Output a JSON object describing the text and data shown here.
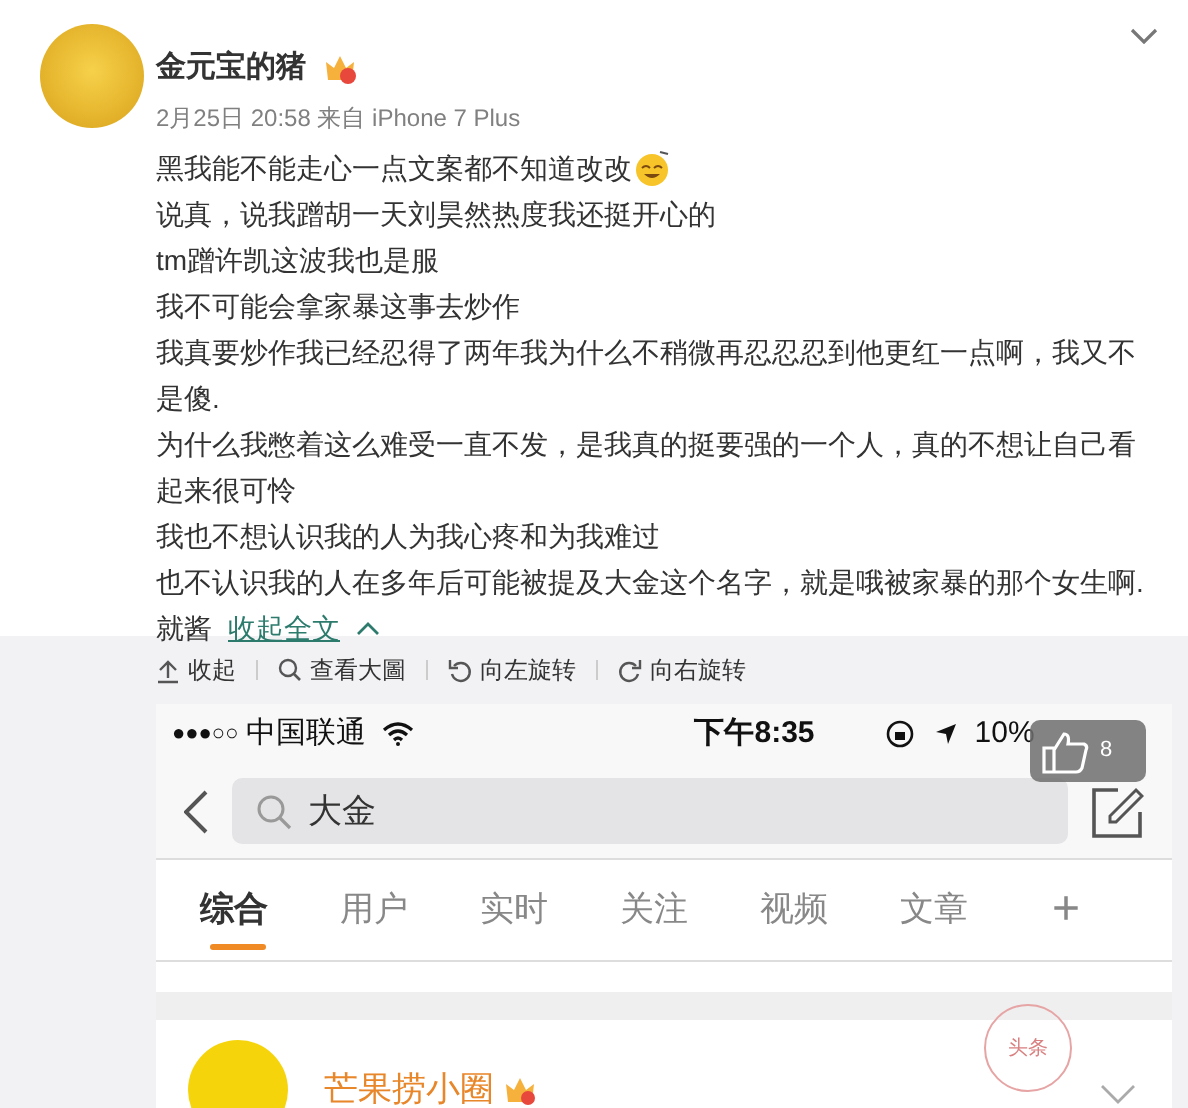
{
  "post": {
    "author": "金元宝的猪",
    "meta": "2月25日 20:58 来自 iPhone 7 Plus",
    "paragraphs": [
      "黑我能不能走心一点文案都不知道改改",
      "说真，说我蹭胡一天刘昊然热度我还挺开心的",
      "tm蹭许凯这波我也是服",
      "我不可能会拿家暴这事去炒作",
      "我真要炒作我已经忍得了两年我为什么不稍微再忍忍忍到他更红一点啊，我又不是傻.",
      "为什么我憋着这么难受一直不发，是我真的挺要强的一个人，真的不想让自己看起来很可怜",
      "我也不想认识我的人为我心疼和为我难过",
      "也不认识我的人在多年后可能被提及大金这个名字，就是哦被家暴的那个女生啊."
    ],
    "last_text": "就酱",
    "collapse_link": "收起全文"
  },
  "image_toolbar": [
    {
      "kind": "collapse",
      "label": "收起"
    },
    {
      "kind": "zoom",
      "label": "查看大圖"
    },
    {
      "kind": "rotate-left",
      "label": "向左旋转"
    },
    {
      "kind": "rotate-right",
      "label": "向右旋转"
    }
  ],
  "screenshot": {
    "status_bar": {
      "signal": "●●●○○",
      "carrier": "中国联通",
      "time": "下午8:35",
      "battery": "10%"
    },
    "search": {
      "value": "大金"
    },
    "tabs": [
      {
        "label": "综合",
        "selected": true
      },
      {
        "label": "用户",
        "selected": false
      },
      {
        "label": "实时",
        "selected": false
      },
      {
        "label": "关注",
        "selected": false
      },
      {
        "label": "视频",
        "selected": false
      },
      {
        "label": "文章",
        "selected": false
      }
    ],
    "add_tab": "+",
    "result": {
      "author": "芒果捞小圈",
      "stamp": "头条"
    }
  },
  "like_badge": {
    "count": "8"
  }
}
